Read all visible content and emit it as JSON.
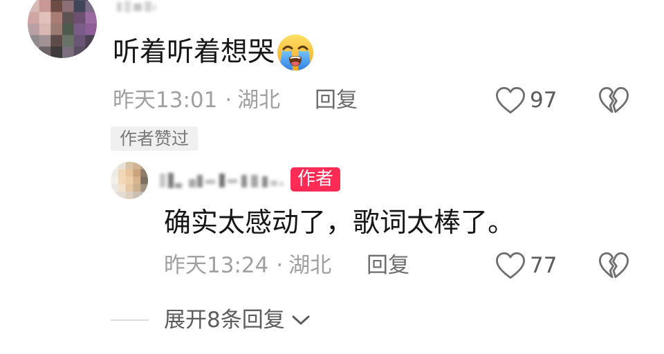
{
  "comment": {
    "text": "听着听着想哭",
    "time": "昨天13:01",
    "location": "湖北",
    "reply_label": "回复",
    "like_count": "97",
    "creator_liked_badge": "作者赞过"
  },
  "reply": {
    "author_badge": "作者",
    "text": "确实太感动了，歌词太棒了。",
    "time": "昨天13:24",
    "location": "湖北",
    "reply_label": "回复",
    "like_count": "77"
  },
  "meta_separator": "·",
  "expand_replies": {
    "label": "展开8条回复"
  },
  "icons": {
    "emoji": "loudly-crying-face-emoji",
    "like": "heart-outline-icon",
    "dislike": "broken-heart-icon",
    "expand": "chevron-down-icon"
  },
  "colors": {
    "author_badge": "#fe2c55",
    "primary_text": "#161616",
    "secondary_text": "#a0a0a0"
  }
}
